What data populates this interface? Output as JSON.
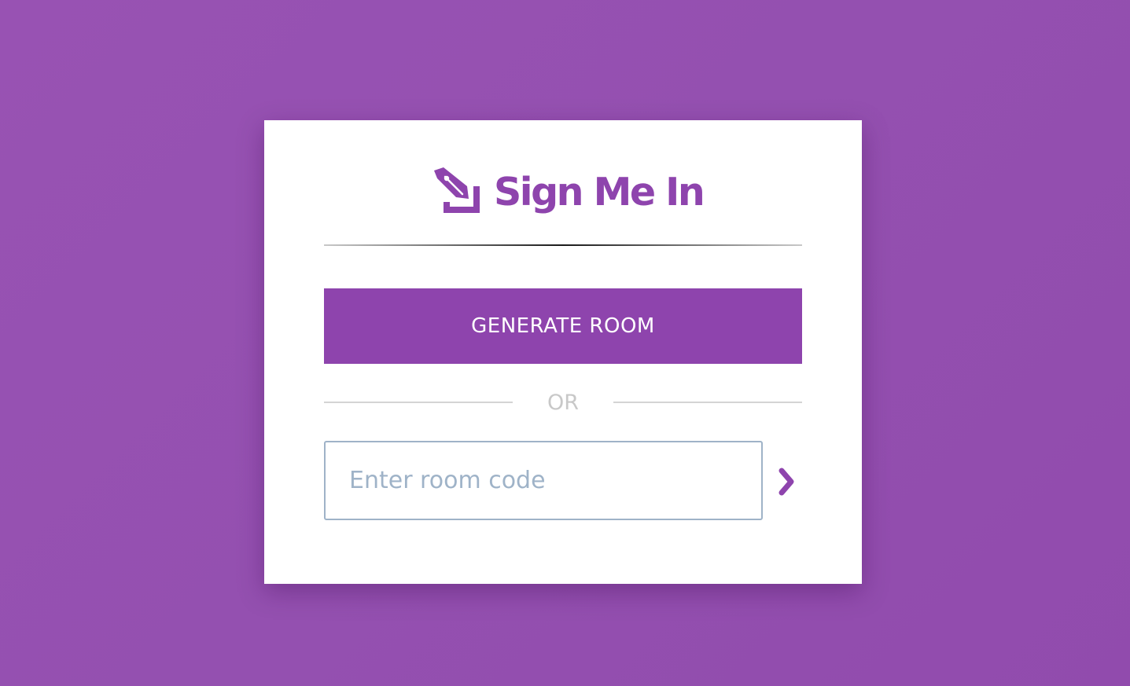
{
  "brand": {
    "name": "Sign Me In",
    "logo_icon": "fountain-pen-nib-icon",
    "color": "#8e44ad"
  },
  "actions": {
    "generate_label": "GENERATE ROOM",
    "separator_label": "OR",
    "room_code_placeholder": "Enter room code",
    "room_code_value": "",
    "submit_icon": "chevron-right-icon"
  },
  "colors": {
    "background": "#9450b0",
    "accent": "#8e44ad",
    "input_border": "#9fb3c8"
  }
}
